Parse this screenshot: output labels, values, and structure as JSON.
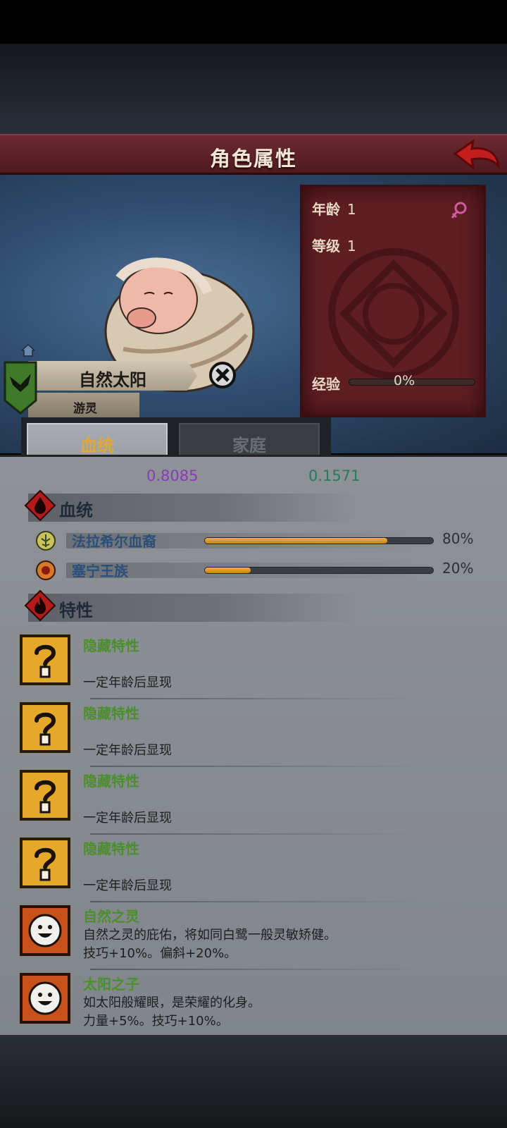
{
  "header": {
    "title": "角色属性"
  },
  "character": {
    "name": "自然太阳",
    "title": "游灵"
  },
  "stats": {
    "age_label": "年龄",
    "age_value": "1",
    "level_label": "等级",
    "level_value": "1",
    "exp_label": "经验",
    "exp_value": "0%",
    "exp_fraction": 0
  },
  "tabs": [
    {
      "label": "血统",
      "active": true
    },
    {
      "label": "家庭",
      "active": false
    }
  ],
  "partial_values": {
    "left": "0.8085",
    "right": "0.1571"
  },
  "bloodline_section": {
    "title": "血统",
    "items": [
      {
        "name": "法拉希尔血裔",
        "percent": "80%",
        "fraction": 0.8
      },
      {
        "name": "塞宁王族",
        "percent": "20%",
        "fraction": 0.2
      }
    ]
  },
  "traits_section": {
    "title": "特性",
    "items": [
      {
        "name": "隐藏特性",
        "desc1": "",
        "desc2": "一定年龄后显现",
        "icon": "question-icon"
      },
      {
        "name": "隐藏特性",
        "desc1": "",
        "desc2": "一定年龄后显现",
        "icon": "question-icon"
      },
      {
        "name": "隐藏特性",
        "desc1": "",
        "desc2": "一定年龄后显现",
        "icon": "question-icon"
      },
      {
        "name": "隐藏特性",
        "desc1": "",
        "desc2": "一定年龄后显现",
        "icon": "question-icon"
      },
      {
        "name": "自然之灵",
        "desc1": "自然之灵的庇佑，将如同白鹭一般灵敏矫健。",
        "desc2": "技巧+10%。偏斜+20%。",
        "icon": "sun-face-icon"
      },
      {
        "name": "太阳之子",
        "desc1": "如太阳般耀眼，是荣耀的化身。",
        "desc2": "力量+5%。技巧+10%。",
        "icon": "sun-face-icon"
      }
    ]
  }
}
